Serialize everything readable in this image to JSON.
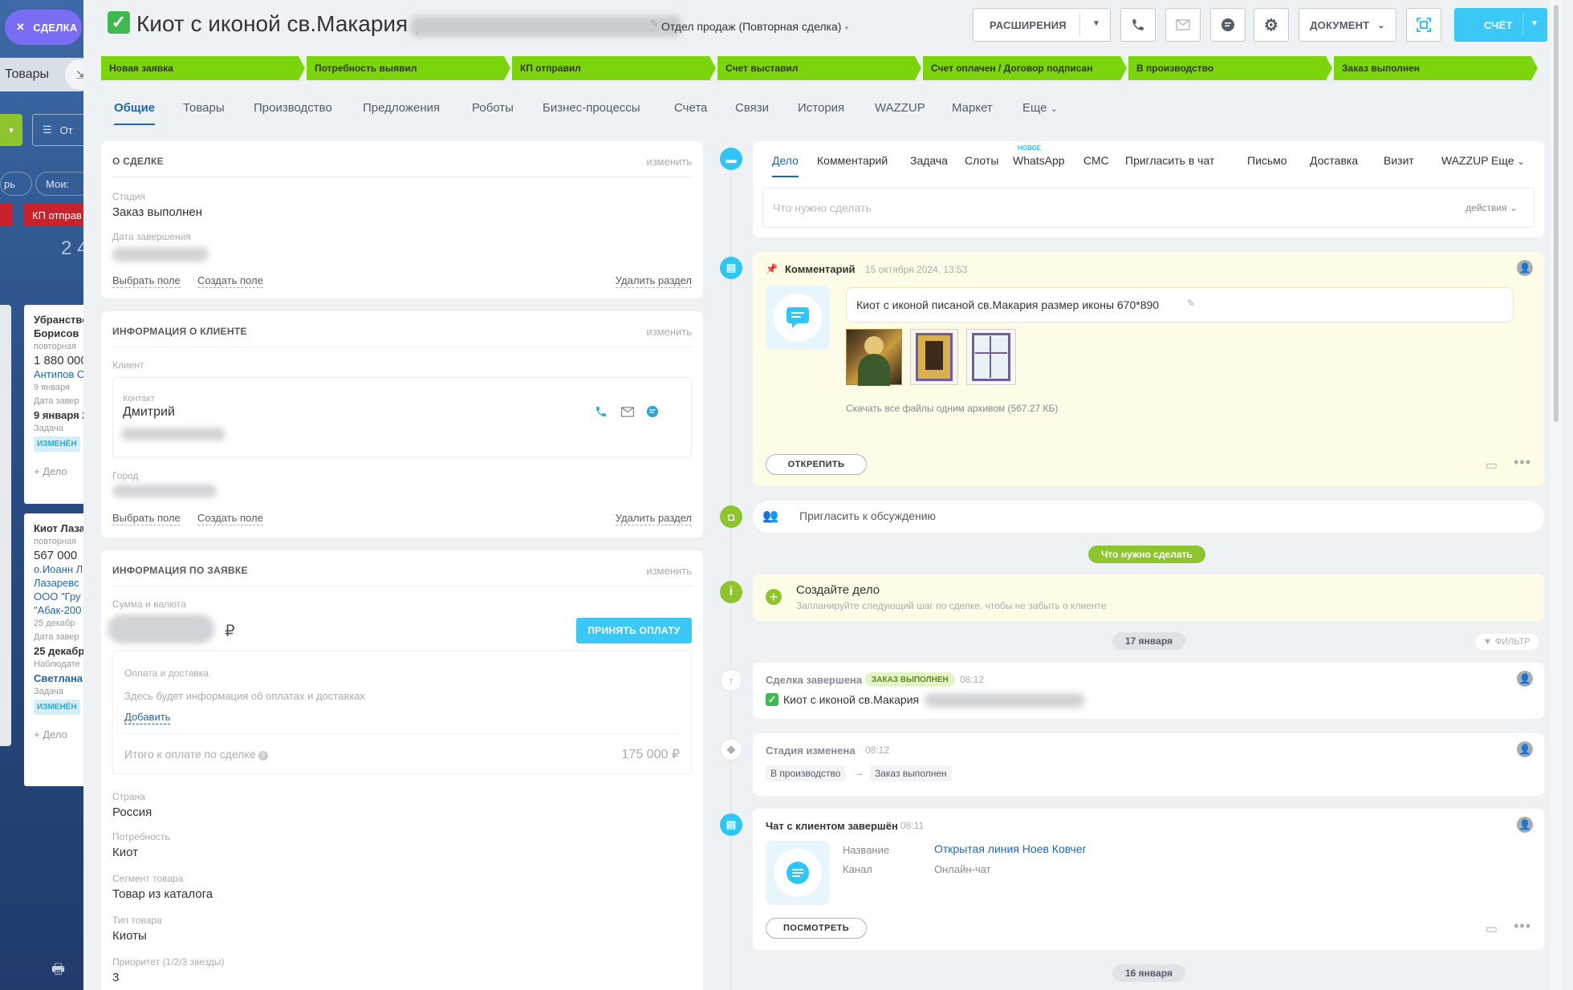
{
  "background": {
    "tag_label": "СДЕЛКА",
    "tovary_label": "Товары",
    "filter_label": "От",
    "pill1": "рь",
    "pill2": "Мои:",
    "stage_label": "КП отправ",
    "bignum": "2 4",
    "card1": {
      "title": "Убранство",
      "title2": "Борисов",
      "type": "повторная",
      "sum": "1 880 000",
      "person": "Антипов С",
      "date": "9 января",
      "close_label": "Дата завер",
      "close_date": "9 января 2",
      "task_label": "Задача",
      "badge": "ИЗМЕНЁН",
      "add": "+ Дело"
    },
    "card2": {
      "title": "Киот Лаза",
      "type": "повторная",
      "sum": "567 000",
      "person": "о.Иоанн Л",
      "person2": "Лазаревс",
      "company": "ООО \"Гру",
      "company2": "\"Абак-200",
      "date": "25 декабр",
      "close_label": "Дата завер",
      "close_date": "25 декабр",
      "observer_label": "Наблюдате",
      "observer": "Светлана",
      "task_label": "Задача",
      "badge": "ИЗМЕНЁН",
      "add": "+ Дело"
    }
  },
  "header": {
    "title": "Киот с иконой св.Макария ,",
    "category": "Отдел продаж (Повторная сделка)",
    "btn_extensions": "РАСШИРЕНИЯ",
    "btn_document": "ДОКУМЕНТ",
    "btn_invoice": "СЧЁТ"
  },
  "stages": [
    "Новая заявка",
    "Потребность выявил",
    "КП отправил",
    "Счет выставил",
    "Счет оплачен / Договор подписан",
    "В производство",
    "Заказ выполнен"
  ],
  "tabs": [
    "Общие",
    "Товары",
    "Производство",
    "Предложения",
    "Роботы",
    "Бизнес-процессы",
    "Счета",
    "Связи",
    "История",
    "WAZZUP",
    "Маркет",
    "Еще"
  ],
  "about": {
    "heading": "О СДЕЛКЕ",
    "edit": "изменить",
    "stage_label": "Стадия",
    "stage_value": "Заказ выполнен",
    "close_label": "Дата завершения",
    "select_field": "Выбрать поле",
    "create_field": "Создать поле",
    "delete_section": "Удалить раздел"
  },
  "client": {
    "heading": "ИНФОРМАЦИЯ О КЛИЕНТЕ",
    "edit": "изменить",
    "client_label": "Клиент",
    "contact_label": "Контакт",
    "contact_name": "Дмитрий",
    "city_label": "Город",
    "select_field": "Выбрать поле",
    "create_field": "Создать поле",
    "delete_section": "Удалить раздел"
  },
  "order": {
    "heading": "ИНФОРМАЦИЯ ПО ЗАЯВКЕ",
    "edit": "изменить",
    "sum_label": "Сумма и валюта",
    "currency": "₽",
    "accept_payment": "ПРИНЯТЬ ОПЛАТУ",
    "pay_title": "Оплата и доставка",
    "pay_info": "Здесь будет информация об оплатах и доставках",
    "pay_add": "Добавить",
    "total_label": "Итого к оплате по сделке",
    "total_value": "175 000 ₽",
    "country_label": "Страна",
    "country_value": "Россия",
    "need_label": "Потребность",
    "need_value": "Киот",
    "segment_label": "Сегмент товара",
    "segment_value": "Товар из каталога",
    "type_label": "Тип товара",
    "type_value": "Киоты",
    "priority_label": "Приоритет (1/2/3 звезды)",
    "priority_value": "3"
  },
  "activity": {
    "tabs": [
      "Дело",
      "Комментарий",
      "Задача",
      "Слоты",
      "WhatsApp",
      "СМС",
      "Пригласить в чат",
      "Письмо",
      "Доставка",
      "Визит",
      "WAZZUP",
      "Еще"
    ],
    "new_badge": "НОВОЕ",
    "placeholder": "Что нужно сделать",
    "actions": "действия"
  },
  "comment": {
    "title": "Комментарий",
    "time": "15 октября 2024, 13:53",
    "text": "Киот с иконой писаной св.Макария размер иконы 670*890",
    "download": "Скачать все файлы одним архивом (567.27 КБ)",
    "unpin": "ОТКРЕПИТЬ"
  },
  "invite": {
    "text": "Пригласить к обсуждению"
  },
  "todo_pill": "Что нужно сделать",
  "create_task": {
    "title": "Создайте дело",
    "subtitle": "Запланируйте следующий шаг по сделке, чтобы не забыть о клиенте"
  },
  "date1": "17 января",
  "filter": "ФИЛЬТР",
  "closed": {
    "title": "Сделка завершена",
    "badge": "ЗАКАЗ ВЫПОЛНЕН",
    "time": "08:12",
    "text": "Киот с иконой св.Макария"
  },
  "stage_changed": {
    "title": "Стадия изменена",
    "time": "08:12",
    "from": "В производство",
    "arrow": "→",
    "to": "Заказ выполнен"
  },
  "chat": {
    "title": "Чат с клиентом завершён",
    "time": "08:11",
    "name_label": "Название",
    "name_value": "Открытая линия Ноев Ковчег",
    "channel_label": "Канал",
    "channel_value": "Онлайн-чат",
    "view": "ПОСМОТРЕТЬ"
  },
  "date2": "16 января",
  "colors": {
    "stage": "#7cd40c",
    "accent": "#2fc6f6",
    "link": "#2067b0"
  }
}
